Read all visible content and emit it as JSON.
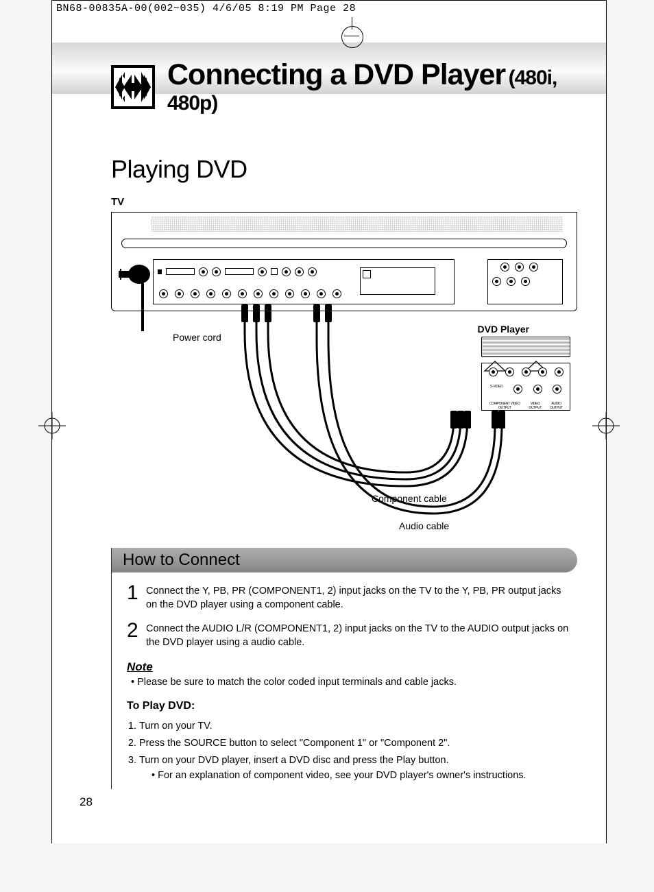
{
  "print_header": "BN68-00835A-00(002~035)  4/6/05  8:19 PM  Page 28",
  "title": {
    "main": "Connecting a DVD Player",
    "sub": "(480i, 480p)"
  },
  "section": "Playing DVD",
  "diagram": {
    "tv_label": "TV",
    "power_cord": "Power cord",
    "dvd_label": "DVD Player",
    "component_cable": "Component cable",
    "audio_cable": "Audio cable",
    "jack_labels": {
      "svideo": "S-VIDEO",
      "component_out": "COMPONENT VIDEO OUTPUT",
      "video_out": "VIDEO OUTPUT",
      "audio_out": "AUDIO OUTPUT"
    }
  },
  "how": {
    "header": "How to Connect",
    "steps": [
      "Connect the Y, PB, PR (COMPONENT1, 2) input jacks on the TV to the Y, PB, PR output jacks on the DVD player using a component cable.",
      "Connect the AUDIO L/R (COMPONENT1, 2) input jacks on the TV to the AUDIO output jacks on the DVD player using a audio cable."
    ],
    "note_h": "Note",
    "note_body": "•  Please be sure to match the color coded input terminals and cable jacks.",
    "play_h": "To Play DVD:",
    "play": [
      "Turn on your TV.",
      "Press the SOURCE button to select \"Component 1\" or \"Component 2\".",
      "Turn on your DVD player, insert a DVD disc and press the Play button."
    ],
    "play_sub": "• For an explanation of component video, see your DVD player's owner's instructions."
  },
  "page_number": "28"
}
